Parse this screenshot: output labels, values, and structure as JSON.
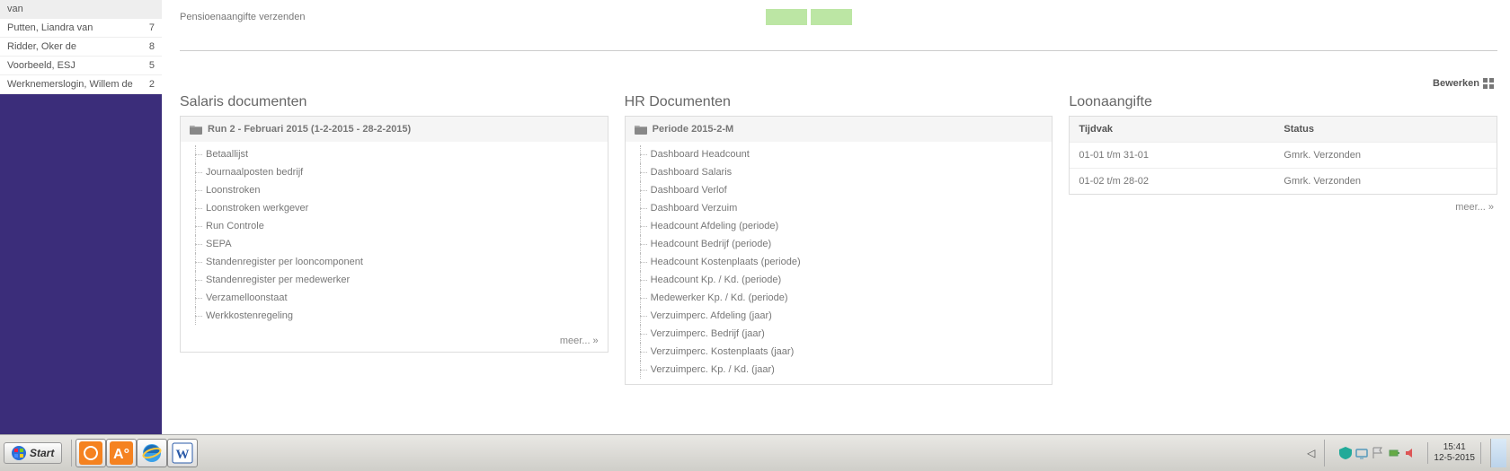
{
  "sidebar": {
    "employees": [
      {
        "name": "van",
        "num": ""
      },
      {
        "name": "Putten, Liandra van",
        "num": "7"
      },
      {
        "name": "Ridder, Oker de",
        "num": "8"
      },
      {
        "name": "Voorbeeld, ESJ",
        "num": "5"
      },
      {
        "name": "Werknemerslogin, Willem de",
        "num": "2"
      }
    ]
  },
  "topbar": {
    "label": "Pensioenaangifte verzenden"
  },
  "edit_label": "Bewerken",
  "salaris": {
    "title": "Salaris documenten",
    "folder": "Run 2 - Februari 2015 (1-2-2015 - 28-2-2015)",
    "items": [
      "Betaallijst",
      "Journaalposten bedrijf",
      "Loonstroken",
      "Loonstroken werkgever",
      "Run Controle",
      "SEPA",
      "Standenregister per looncomponent",
      "Standenregister per medewerker",
      "Verzamelloonstaat",
      "Werkkostenregeling"
    ],
    "more": "meer...  »"
  },
  "hr": {
    "title": "HR Documenten",
    "folder": "Periode 2015-2-M",
    "items": [
      "Dashboard Headcount",
      "Dashboard Salaris",
      "Dashboard Verlof",
      "Dashboard Verzuim",
      "Headcount Afdeling (periode)",
      "Headcount Bedrijf (periode)",
      "Headcount Kostenplaats (periode)",
      "Headcount Kp. / Kd. (periode)",
      "Medewerker Kp. / Kd. (periode)",
      "Verzuimperc. Afdeling (jaar)",
      "Verzuimperc. Bedrijf (jaar)",
      "Verzuimperc. Kostenplaats (jaar)",
      "Verzuimperc. Kp. / Kd. (jaar)"
    ]
  },
  "loon": {
    "title": "Loonaangifte",
    "col_tijdvak": "Tijdvak",
    "col_status": "Status",
    "rows": [
      {
        "t": "01-01 t/m 31-01",
        "s": "Gmrk. Verzonden"
      },
      {
        "t": "01-02 t/m 28-02",
        "s": "Gmrk. Verzonden"
      }
    ],
    "more": "meer...  »"
  },
  "taskbar": {
    "start": "Start",
    "clock_time": "15:41",
    "clock_date": "12-5-2015"
  }
}
